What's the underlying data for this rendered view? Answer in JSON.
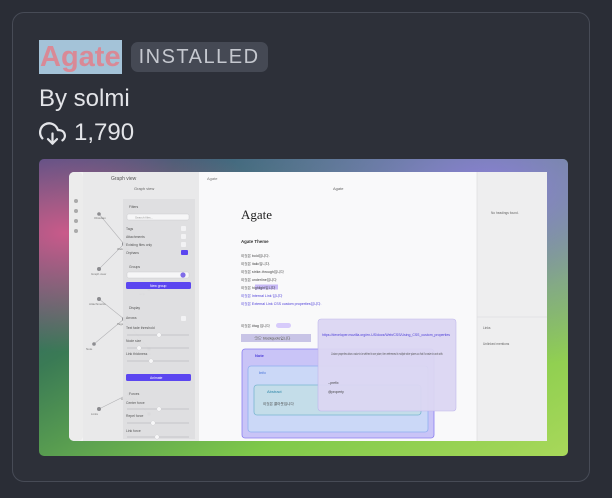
{
  "theme": {
    "name": "Agate",
    "status": "INSTALLED",
    "author": "By solmi",
    "downloads": "1,790"
  },
  "icons": {
    "downloads": "download-cloud-icon"
  },
  "colors": {
    "name_text": "#d98996",
    "name_highlight": "#a4c3d8",
    "badge_bg": "#454954"
  },
  "preview": {
    "sidebar": {
      "tab": "Graph view"
    },
    "graph": {
      "header": "Graph view",
      "filters": "Filters",
      "search": "Search files...",
      "tags": "Tags",
      "attachments": "Attachments",
      "existing": "Existing files only",
      "orphans": "Orphans",
      "groups": "Groups",
      "new_group": "New group",
      "display": "Display",
      "arrows": "Arrows",
      "fade": "Text fade threshold",
      "node_size": "Node size",
      "link_thickness": "Link thickness",
      "animate": "Animate",
      "forces": "Forces",
      "center": "Center force",
      "repel": "Repel force",
      "link_force": "Link force",
      "nodes": [
        "Obsidian",
        "Welcome",
        "Graph view",
        "Help",
        "Attachments",
        "Tags",
        "Groups",
        "Note",
        "Links",
        "Core plugins"
      ]
    },
    "editor": {
      "tab": "Agate",
      "header": "Agate",
      "title": "Agate",
      "section": "Agate Theme",
      "lines": [
        "이것은 bold입니다.",
        "이것은 italic입니다.",
        "이것은 strike-through입니다",
        "이것은 underline입니다",
        "이것은 highlight입니다",
        "이것은 Internal Link 입니다",
        "이것은 External Link CSS custom properties입니다.",
        "이것은 #tag 입니다"
      ],
      "code": "'코드' blockquote입니다",
      "note": "Note",
      "info": "Info",
      "abstract": "Abstract",
      "abstract_text": "이것은 콜아웃입니다"
    },
    "popover": {
      "link": "https://developer.mozilla.org/en-US/docs/Web/CSS/Using_CSS_custom_properties",
      "text": "Custom properties allow a value to be defined in one place, then referenced in multiple other places so that it's easier to work with.",
      "bullets": [
        "--prefix",
        "@property"
      ]
    },
    "right": {
      "headings": "No headings found.",
      "outgoing": "Links",
      "unlinked": "Unlinked mentions"
    }
  }
}
